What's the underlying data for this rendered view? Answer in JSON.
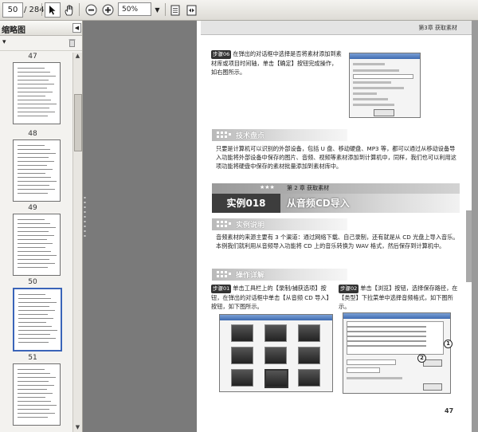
{
  "toolbar": {
    "current_page": "50",
    "total_pages": "/ 284",
    "zoom": "50%",
    "icons": [
      "select-arrow-icon",
      "hand-icon",
      "zoom-out-icon",
      "zoom-in-icon",
      "fit-page-icon",
      "fit-width-icon"
    ]
  },
  "sidebar": {
    "title": "缩略图",
    "options_arrow": "▾",
    "thumbnails": [
      {
        "label": "47"
      },
      {
        "label": "48"
      },
      {
        "label": "49"
      },
      {
        "label": "50"
      },
      {
        "label": "51"
      }
    ]
  },
  "document": {
    "header": "第3章    获取素材",
    "step06_label": "步骤06",
    "step06_text": "在弹出的对话框中选择是否将素材添加到素材库或项目时间轴，单击【确定】按钮完成操作，如右图所示。",
    "section_tech": "技术盘点",
    "tech_text": "只要是计算机可以识别的外部设备，包括 U 盘、移动硬盘、MP3 等，都可以通过从移动设备导入功能将外部设备中保存的图片、音频、视频等素材添加到计算机中，同样，我们也可以利用这项功能将硬盘中保存的素材批量添加到素材库中。",
    "stars": "★★★",
    "chapter_tag": "第 2 章    获取素材",
    "example_label": "实例018",
    "example_title": "从音频CD导入",
    "section_desc": "实例说明",
    "desc_text": "音频素材的来源主要有 3 个渠道：通过网络下载、自己录制，还有就是从 CD 光盘上导入音乐。本例我们就利用从音频导入功能将 CD 上的音乐转换为 WAV 格式，然后保存到计算机中。",
    "section_steps": "操作详解",
    "step01_label": "步骤01",
    "step01_text": "单击工具栏上的【录制/捕获选项】按钮，在弹出的对话框中单击【从音频 CD 导入】按钮，如下图所示。",
    "step02_label": "步骤02",
    "step02_text": "单击【浏览】按钮，选择保存路径，在【类型】下拉菜单中选择音频格式，如下图所示。",
    "callout_1": "1",
    "callout_2": "2",
    "page_number": "47"
  }
}
